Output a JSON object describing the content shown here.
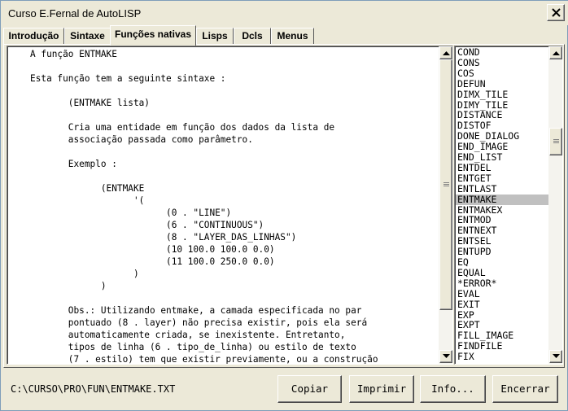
{
  "window": {
    "title": "Curso E.Fernal de AutoLISP"
  },
  "tabs": [
    {
      "label": "Introdução"
    },
    {
      "label": "Sintaxe"
    },
    {
      "label": "Funções nativas"
    },
    {
      "label": "Lisps"
    },
    {
      "label": "Dcls"
    },
    {
      "label": "Menus"
    }
  ],
  "active_tab": "Funções nativas",
  "document": {
    "lines": [
      "   A função ENTMAKE",
      "",
      "   Esta função tem a seguinte sintaxe :",
      "",
      "          (ENTMAKE lista)",
      "",
      "          Cria uma entidade em função dos dados da lista de",
      "          associação passada como parâmetro.",
      "",
      "          Exemplo :",
      "",
      "                (ENTMAKE",
      "                      '(",
      "                            (0 . \"LINE\")",
      "                            (6 . \"CONTINUOUS\")",
      "                            (8 . \"LAYER_DAS_LINHAS\")",
      "                            (10 100.0 100.0 0.0)",
      "                            (11 100.0 250.0 0.0)",
      "                      )",
      "                )",
      "",
      "          Obs.: Utilizando entmake, a camada especificada no par",
      "          pontuado (8 . layer) não precisa existir, pois ela será",
      "          automaticamente criada, se inexistente. Entretanto,",
      "          tipos de linha (6 . tipo_de_linha) ou estilo de texto",
      "          (7 . estilo) tem que existir previamente, ou a construção"
    ]
  },
  "function_list": {
    "items": [
      "COND",
      "CONS",
      "COS",
      "DEFUN",
      "DIMX_TILE",
      "DIMY_TILE",
      "DISTANCE",
      "DISTOF",
      "DONE_DIALOG",
      "END_IMAGE",
      "END_LIST",
      "ENTDEL",
      "ENTGET",
      "ENTLAST",
      "ENTMAKE",
      "ENTMAKEX",
      "ENTMOD",
      "ENTNEXT",
      "ENTSEL",
      "ENTUPD",
      "EQ",
      "EQUAL",
      "*ERROR*",
      "EVAL",
      "EXIT",
      "EXP",
      "EXPT",
      "FILL_IMAGE",
      "FINDFILE",
      "FIX"
    ],
    "selected": "ENTMAKE"
  },
  "status": {
    "path": "C:\\CURSO\\PRO\\FUN\\ENTMAKE.TXT"
  },
  "buttons": {
    "copy": "Copiar",
    "print": "Imprimir",
    "info": "Info...",
    "close": "Encerrar"
  }
}
